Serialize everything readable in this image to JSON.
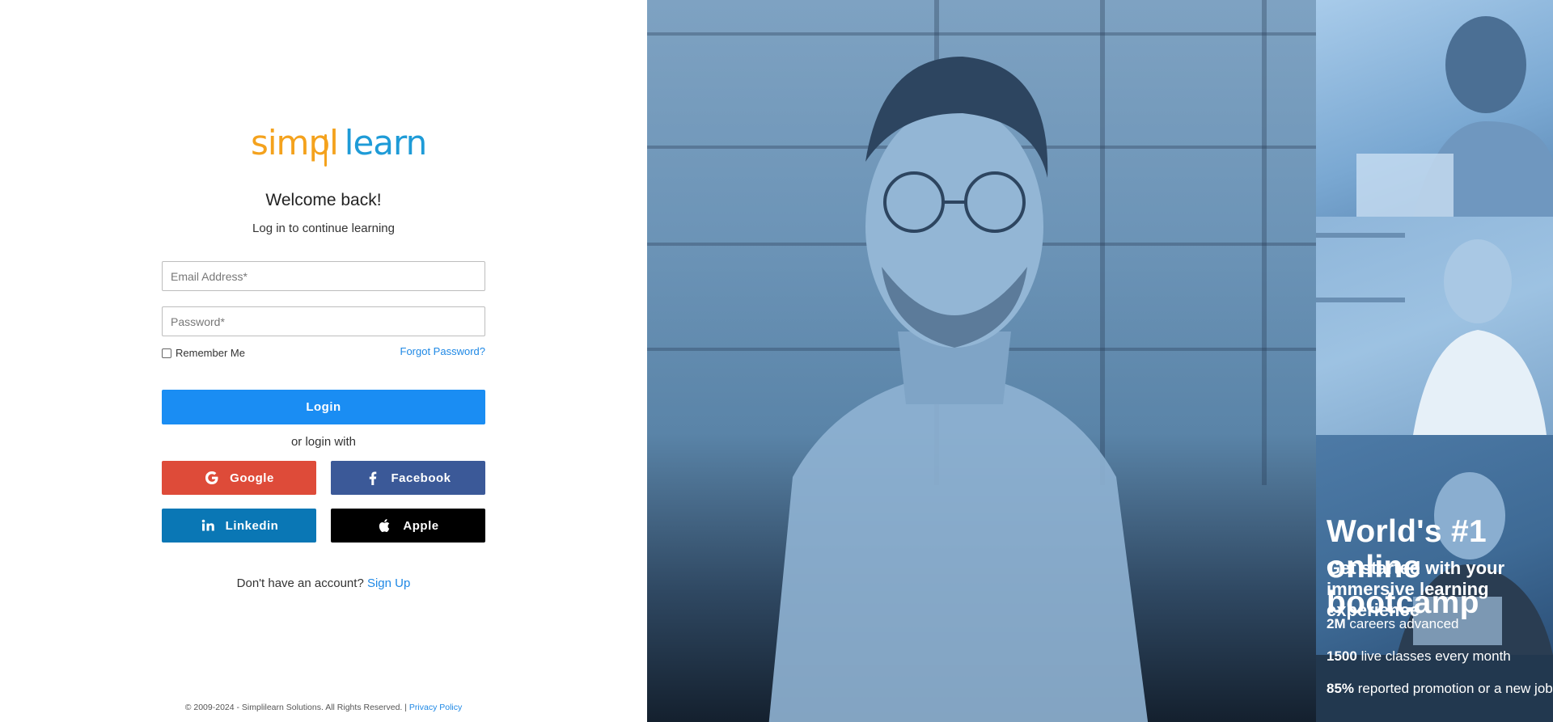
{
  "brand": {
    "logo_part1": "simpl",
    "logo_part2": "learn",
    "logo_colors": {
      "orange": "#f4a21d",
      "blue": "#1e9bd7"
    }
  },
  "login": {
    "title": "Welcome back!",
    "subtitle": "Log in to continue learning",
    "email_placeholder": "Email Address*",
    "password_placeholder": "Password*",
    "remember_label": "Remember Me",
    "remember_checked": false,
    "forgot_label": "Forgot Password?",
    "login_button": "Login",
    "or_text": "or login with",
    "social": {
      "google": "Google",
      "facebook": "Facebook",
      "linkedin": "Linkedin",
      "apple": "Apple"
    },
    "signup_prompt": "Don't have an account?",
    "signup_link": "Sign Up"
  },
  "footer": {
    "copyright": "© 2009-2024 - Simplilearn Solutions. All Rights Reserved. |",
    "privacy": "Privacy Policy"
  },
  "promo": {
    "headline": "World's #1 online bootcamp",
    "subheadline": "Get started with your immersive learning experience",
    "stats": [
      {
        "value": "2M",
        "label": "careers advanced"
      },
      {
        "value": "1500",
        "label": "live classes every month"
      },
      {
        "value": "85%",
        "label": "reported promotion or a new job"
      }
    ]
  },
  "colors": {
    "primary_button": "#1a8df3",
    "google": "#de4b39",
    "facebook": "#3b5998",
    "linkedin": "#0a77b5",
    "apple": "#000000",
    "link": "#1e88e5"
  }
}
